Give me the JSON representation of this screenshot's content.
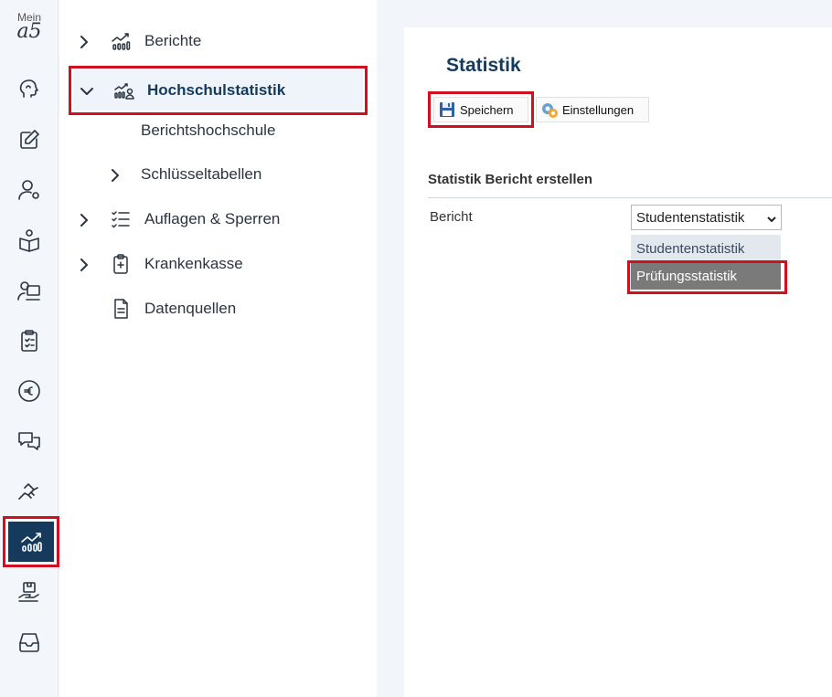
{
  "rail": {
    "logo_top": "Mein",
    "logo_bottom": "a5",
    "icons": [
      "brain-icon",
      "edit-icon",
      "user-settings-icon",
      "book-user-icon",
      "teacher-icon",
      "clipboard-icon",
      "euro-icon",
      "chat-icon",
      "handshake-icon",
      "statistics-icon",
      "hand-box-icon",
      "inbox-icon"
    ]
  },
  "nav": {
    "items": [
      {
        "label": "Berichte",
        "icon": "chart-icon"
      },
      {
        "label": "Hochschulstatistik",
        "icon": "chart-users-icon"
      },
      {
        "label": "Berichtshochschule"
      },
      {
        "label": "Schlüsseltabellen"
      },
      {
        "label": "Auflagen & Sperren",
        "icon": "checklist-icon"
      },
      {
        "label": "Krankenkasse",
        "icon": "medical-clipboard-icon"
      },
      {
        "label": "Datenquellen",
        "icon": "document-icon"
      }
    ]
  },
  "main": {
    "title": "Statistik",
    "toolbar": {
      "save_label": "Speichern",
      "settings_label": "Einstellungen"
    },
    "section_title": "Statistik Bericht erstellen",
    "field_label": "Bericht",
    "select_value": "Studentenstatistik",
    "options": [
      "Studentenstatistik",
      "Prüfungsstatistik"
    ]
  },
  "colors": {
    "accent": "#153a5b",
    "highlight": "#d01020"
  }
}
